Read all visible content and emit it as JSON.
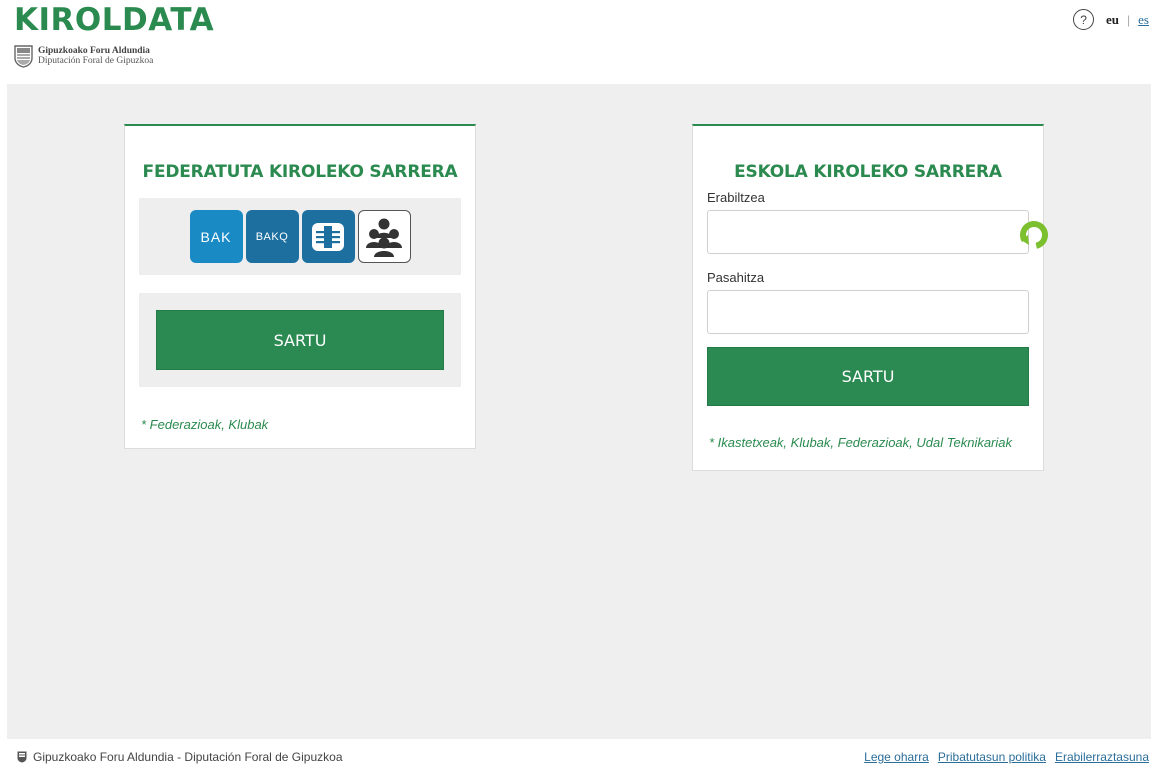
{
  "header": {
    "app_title": "KIROLDATA",
    "gov_line1": "Gipuzkoako Foru Aldundia",
    "gov_line2": "Diputación Foral de Gipuzkoa",
    "help_icon": "question-circle-icon",
    "help_symbol": "?",
    "lang_active": "eu",
    "lang_separator": "|",
    "lang_other": "es"
  },
  "federated": {
    "title": "FEDERATUTA KIROLEKO SARRERA",
    "tiles": [
      {
        "label": "BAK",
        "icon": "bak-icon"
      },
      {
        "label": "BAKQ",
        "icon": "bakq-icon"
      },
      {
        "label": "",
        "icon": "id-card-chip-icon"
      },
      {
        "label": "",
        "icon": "people-group-icon"
      }
    ],
    "button_label": "SARTU",
    "note": "* Federazioak, Klubak"
  },
  "school": {
    "title": "ESKOLA KIROLEKO SARRERA",
    "user_label": "Erabiltzea",
    "user_value": "",
    "password_label": "Pasahitza",
    "password_value": "",
    "refresh_icon": "refresh-icon",
    "button_label": "SARTU",
    "note": "* Ikastetxeak, Klubak, Federazioak, Udal Teknikariak"
  },
  "footer": {
    "org": "Gipuzkoako Foru Aldundia - Diputación Foral de Gipuzkoa",
    "links": [
      "Lege oharra",
      "Pribatutasun politika",
      "Erabilerraztasuna"
    ]
  },
  "colors": {
    "brand_green": "#2b8a4f",
    "button_green": "#2b8a52",
    "bak_blue": "#1a8ac4",
    "bakq_blue": "#1d6fa0",
    "link_blue": "#2b6e9a",
    "background_gray": "#efefef"
  }
}
